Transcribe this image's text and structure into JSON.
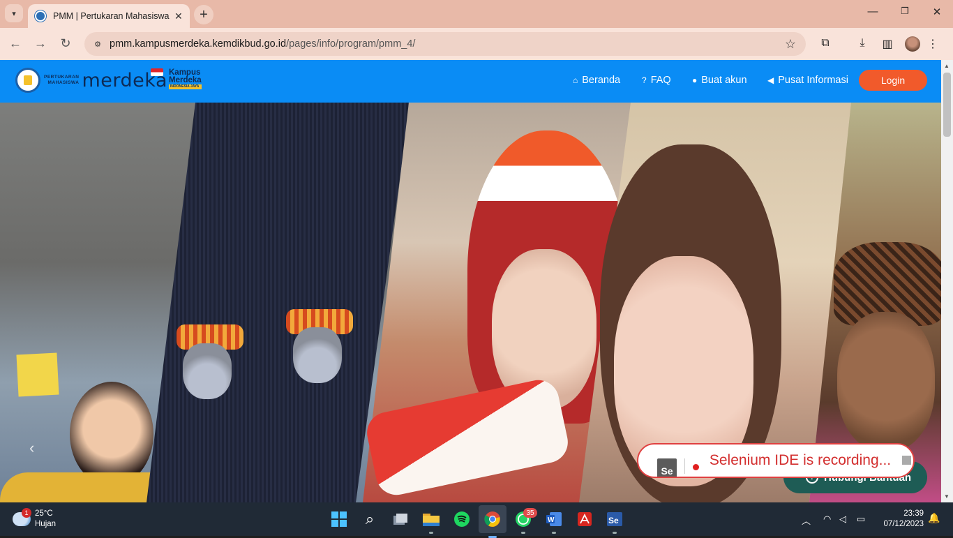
{
  "browser": {
    "tab_title": "PMM | Pertukaran Mahasiswa M",
    "url_domain": "pmm.kampusmerdeka.kemdikbud.go.id",
    "url_path": "/pages/info/program/pmm_4/"
  },
  "site": {
    "logo_text": "merdeka",
    "logo_small_1": "PERTUKARAN",
    "logo_small_2": "MAHASISWA",
    "logo_km_1": "Kampus",
    "logo_km_2": "Merdeka",
    "logo_km_3": "INDONESIA JAYA",
    "menu": [
      {
        "label": "Beranda",
        "icon": "home-icon"
      },
      {
        "label": "FAQ",
        "icon": "question-icon"
      },
      {
        "label": "Buat akun",
        "icon": "user-icon"
      },
      {
        "label": "Pusat Informasi",
        "icon": "megaphone-icon"
      }
    ],
    "login_label": "Login",
    "help_label": "Hubungi Bantuan"
  },
  "selenium": {
    "logo": "Se",
    "text": "Selenium IDE is recording..."
  },
  "taskbar": {
    "weather_badge": "1",
    "temperature": "25°C",
    "condition": "Hujan",
    "whatsapp_badge": "35",
    "time": "23:39",
    "date": "07/12/2023"
  },
  "colors": {
    "nav_bg": "#0a8cf5",
    "login_bg": "#f15a2b",
    "help_bg": "#1e5c55",
    "selenium_red": "#d32f2f"
  }
}
